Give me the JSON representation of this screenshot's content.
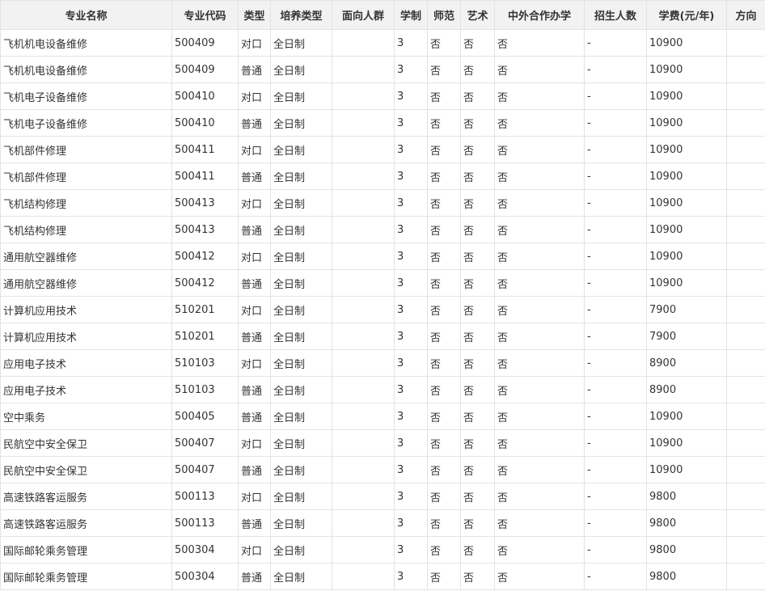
{
  "table": {
    "headers": [
      "专业名称",
      "专业代码",
      "类型",
      "培养类型",
      "面向人群",
      "学制",
      "师范",
      "艺术",
      "中外合作办学",
      "招生人数",
      "学费(元/年)",
      "方向"
    ],
    "rows": [
      [
        "飞机机电设备维修",
        "500409",
        "对口",
        "全日制",
        "",
        "3",
        "否",
        "否",
        "否",
        "-",
        "10900",
        ""
      ],
      [
        "飞机机电设备维修",
        "500409",
        "普通",
        "全日制",
        "",
        "3",
        "否",
        "否",
        "否",
        "-",
        "10900",
        ""
      ],
      [
        "飞机电子设备维修",
        "500410",
        "对口",
        "全日制",
        "",
        "3",
        "否",
        "否",
        "否",
        "-",
        "10900",
        ""
      ],
      [
        "飞机电子设备维修",
        "500410",
        "普通",
        "全日制",
        "",
        "3",
        "否",
        "否",
        "否",
        "-",
        "10900",
        ""
      ],
      [
        "飞机部件修理",
        "500411",
        "对口",
        "全日制",
        "",
        "3",
        "否",
        "否",
        "否",
        "-",
        "10900",
        ""
      ],
      [
        "飞机部件修理",
        "500411",
        "普通",
        "全日制",
        "",
        "3",
        "否",
        "否",
        "否",
        "-",
        "10900",
        ""
      ],
      [
        "飞机结构修理",
        "500413",
        "对口",
        "全日制",
        "",
        "3",
        "否",
        "否",
        "否",
        "-",
        "10900",
        ""
      ],
      [
        "飞机结构修理",
        "500413",
        "普通",
        "全日制",
        "",
        "3",
        "否",
        "否",
        "否",
        "-",
        "10900",
        ""
      ],
      [
        "通用航空器维修",
        "500412",
        "对口",
        "全日制",
        "",
        "3",
        "否",
        "否",
        "否",
        "-",
        "10900",
        ""
      ],
      [
        "通用航空器维修",
        "500412",
        "普通",
        "全日制",
        "",
        "3",
        "否",
        "否",
        "否",
        "-",
        "10900",
        ""
      ],
      [
        "计算机应用技术",
        "510201",
        "对口",
        "全日制",
        "",
        "3",
        "否",
        "否",
        "否",
        "-",
        "7900",
        ""
      ],
      [
        "计算机应用技术",
        "510201",
        "普通",
        "全日制",
        "",
        "3",
        "否",
        "否",
        "否",
        "-",
        "7900",
        ""
      ],
      [
        "应用电子技术",
        "510103",
        "对口",
        "全日制",
        "",
        "3",
        "否",
        "否",
        "否",
        "-",
        "8900",
        ""
      ],
      [
        "应用电子技术",
        "510103",
        "普通",
        "全日制",
        "",
        "3",
        "否",
        "否",
        "否",
        "-",
        "8900",
        ""
      ],
      [
        "空中乘务",
        "500405",
        "普通",
        "全日制",
        "",
        "3",
        "否",
        "否",
        "否",
        "-",
        "10900",
        ""
      ],
      [
        "民航空中安全保卫",
        "500407",
        "对口",
        "全日制",
        "",
        "3",
        "否",
        "否",
        "否",
        "-",
        "10900",
        ""
      ],
      [
        "民航空中安全保卫",
        "500407",
        "普通",
        "全日制",
        "",
        "3",
        "否",
        "否",
        "否",
        "-",
        "10900",
        ""
      ],
      [
        "高速铁路客运服务",
        "500113",
        "对口",
        "全日制",
        "",
        "3",
        "否",
        "否",
        "否",
        "-",
        "9800",
        ""
      ],
      [
        "高速铁路客运服务",
        "500113",
        "普通",
        "全日制",
        "",
        "3",
        "否",
        "否",
        "否",
        "-",
        "9800",
        ""
      ],
      [
        "国际邮轮乘务管理",
        "500304",
        "对口",
        "全日制",
        "",
        "3",
        "否",
        "否",
        "否",
        "-",
        "9800",
        ""
      ],
      [
        "国际邮轮乘务管理",
        "500304",
        "普通",
        "全日制",
        "",
        "3",
        "否",
        "否",
        "否",
        "-",
        "9800",
        ""
      ]
    ]
  }
}
